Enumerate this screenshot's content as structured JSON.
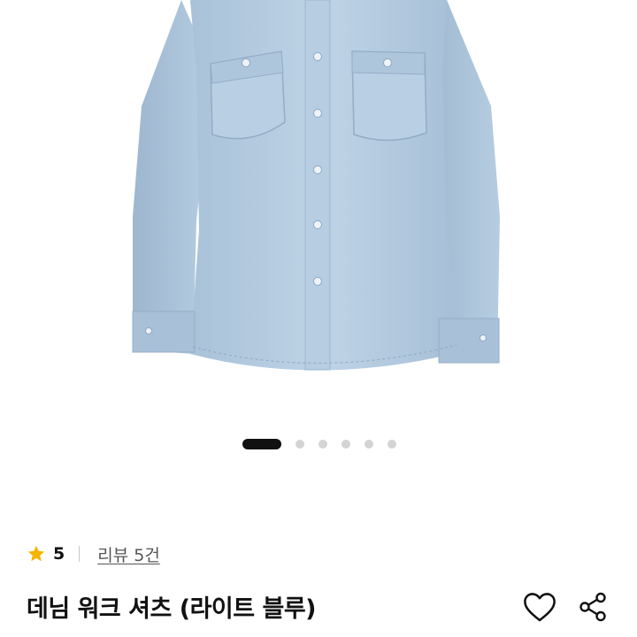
{
  "product": {
    "image_subject": "denim-work-shirt-photo",
    "gallery": {
      "total_images": 6,
      "active_index": 0
    },
    "rating": {
      "score": "5",
      "review_link": "리뷰 5건"
    },
    "title": "데님 워크 셔츠 (라이트 블루)",
    "actions": {
      "like_icon": "heart-icon",
      "share_icon": "share-icon"
    }
  },
  "colors": {
    "star": "#f5b400",
    "dot_active": "#111111",
    "dot_inactive": "#d4d4d4",
    "shirt": "#b3cbe0"
  }
}
